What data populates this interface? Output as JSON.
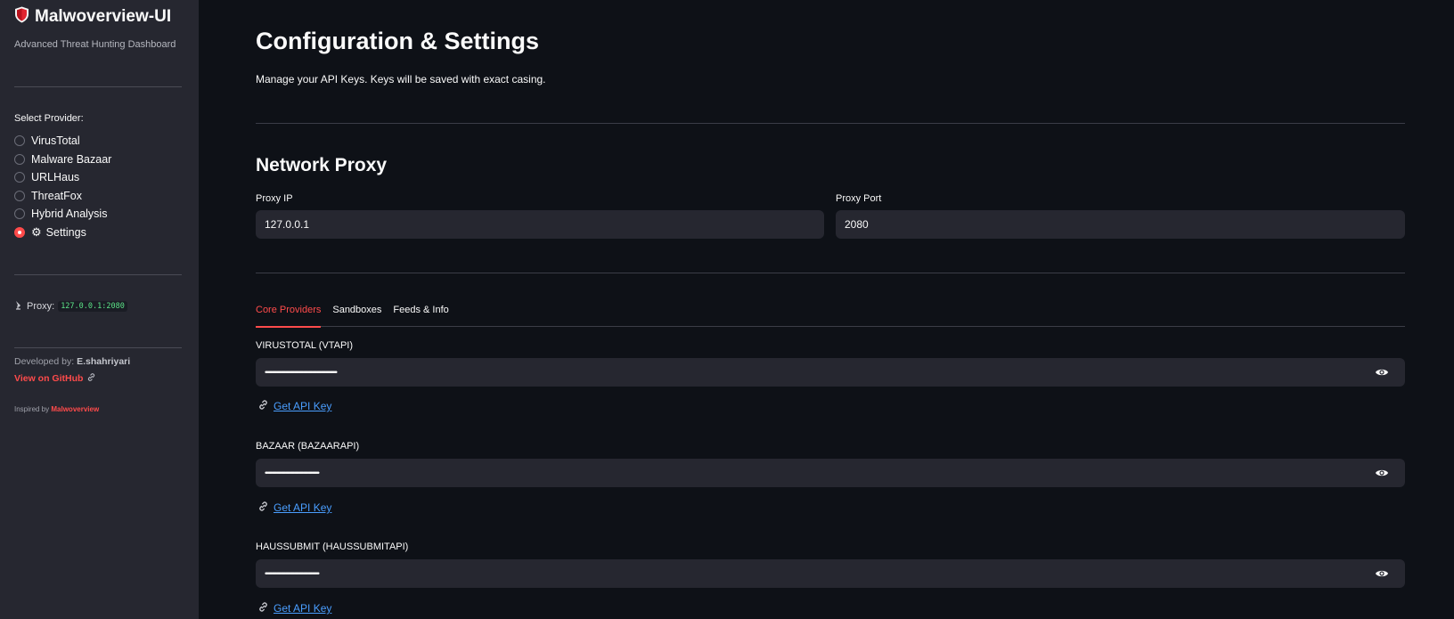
{
  "sidebar": {
    "title": "Malwoverview-UI",
    "logo_icon": "shield-icon",
    "subtitle": "Advanced Threat Hunting Dashboard",
    "select_label": "Select Provider:",
    "providers": [
      {
        "label": "VirusTotal",
        "checked": false
      },
      {
        "label": "Malware Bazaar",
        "checked": false
      },
      {
        "label": "URLHaus",
        "checked": false
      },
      {
        "label": "ThreatFox",
        "checked": false
      },
      {
        "label": "Hybrid Analysis",
        "checked": false
      },
      {
        "label": "Settings",
        "checked": true,
        "icon": "gear-icon"
      }
    ],
    "proxy_label": "Proxy:",
    "proxy_value": "127.0.0.1:2080",
    "developed_by_label": "Developed by:",
    "developer": "E.shahriyari",
    "github_link": "View on GitHub",
    "inspired_label": "Inspired by",
    "inspired_name": "Malwoverview"
  },
  "main": {
    "title": "Configuration & Settings",
    "description": "Manage your API Keys. Keys will be saved with exact casing.",
    "network_proxy": {
      "title": "Network Proxy",
      "ip_label": "Proxy IP",
      "ip_value": "127.0.0.1",
      "port_label": "Proxy Port",
      "port_value": "2080"
    },
    "tabs": [
      {
        "label": "Core Providers",
        "active": true
      },
      {
        "label": "Sandboxes",
        "active": false
      },
      {
        "label": "Feeds & Info",
        "active": false
      }
    ],
    "api_keys": [
      {
        "label": "VIRUSTOTAL (VTAPI)",
        "masked": "••••••••••••••••••••••••••••••••••••••••••••••••••••••••••••••••",
        "link": "Get API Key"
      },
      {
        "label": "BAZAAR (BAZAARAPI)",
        "masked": "••••••••••••••••••••••••••••••••••••••••••••••••",
        "link": "Get API Key"
      },
      {
        "label": "HAUSSUBMIT (HAUSSUBMITAPI)",
        "masked": "••••••••••••••••••••••••••••••••••••••••••••••••",
        "link": "Get API Key"
      }
    ]
  },
  "colors": {
    "accent": "#ff4b4b",
    "link": "#4a9eff",
    "background": "#0e1117",
    "sidebar": "#262730"
  }
}
